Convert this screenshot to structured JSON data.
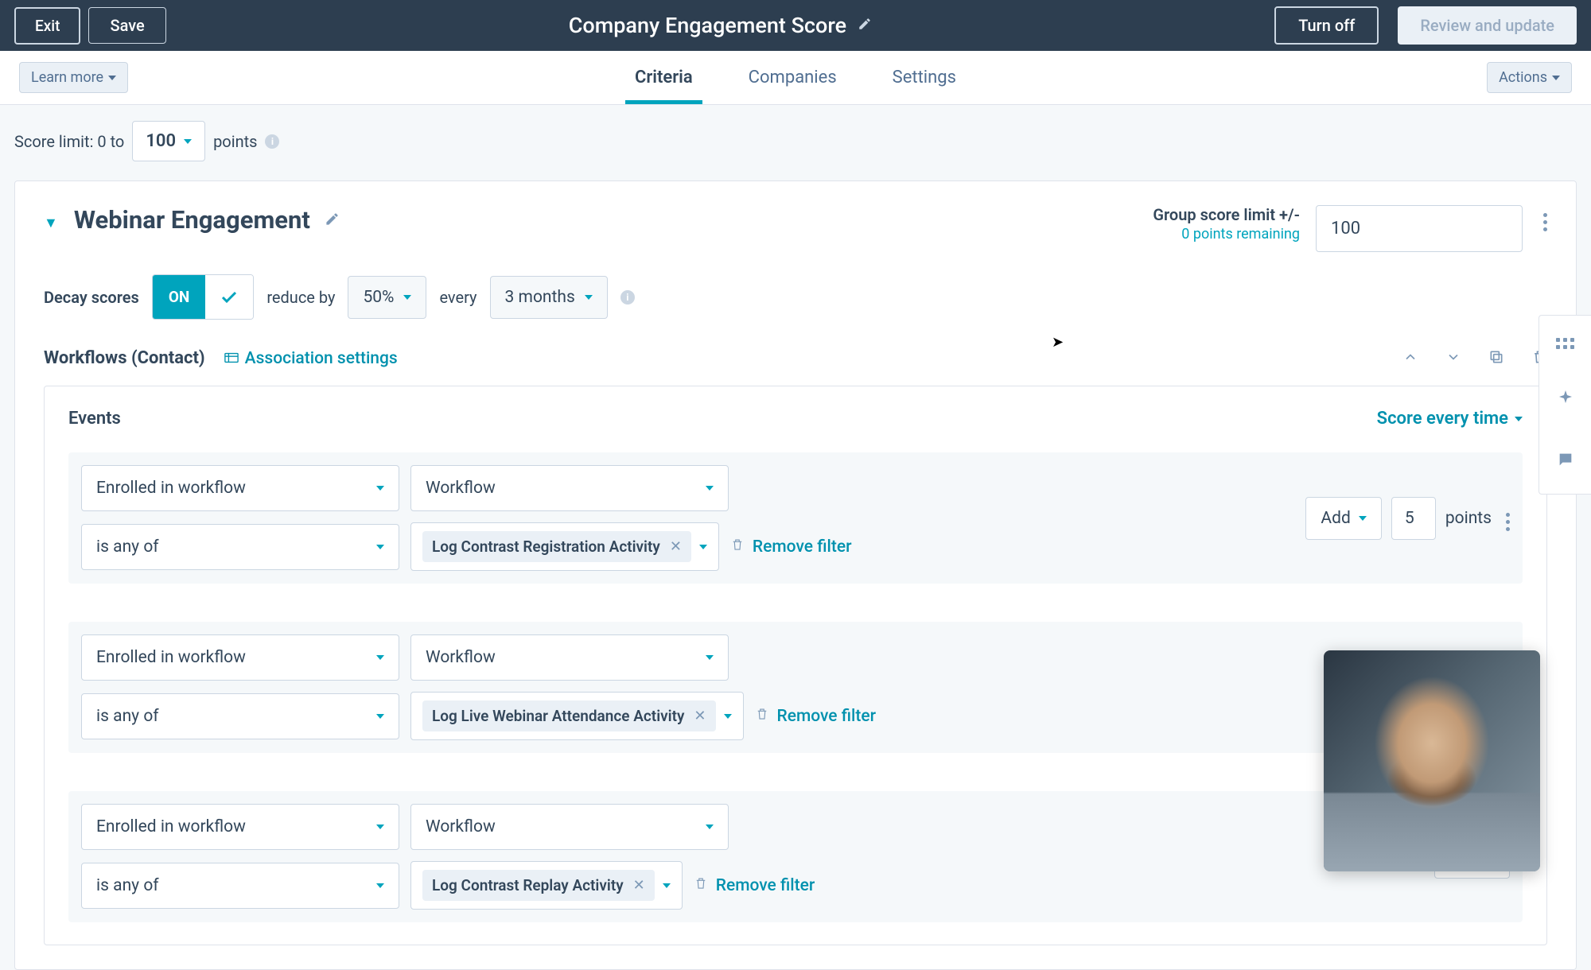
{
  "header": {
    "exit": "Exit",
    "save": "Save",
    "title": "Company Engagement Score",
    "turn_off": "Turn off",
    "review": "Review and update"
  },
  "tabbar": {
    "learn_more": "Learn more",
    "tabs": {
      "criteria": "Criteria",
      "companies": "Companies",
      "settings": "Settings"
    },
    "actions": "Actions"
  },
  "scorelimit": {
    "prefix": "Score limit: 0 to",
    "value": "100",
    "suffix": "points"
  },
  "group": {
    "name": "Webinar Engagement",
    "limit_label": "Group score limit +/-",
    "limit_remaining": "0 points remaining",
    "limit_value": "100"
  },
  "decay": {
    "label": "Decay scores",
    "on": "ON",
    "reduce_by": "reduce by",
    "percent": "50%",
    "every": "every",
    "period": "3 months"
  },
  "section": {
    "title": "Workflows (Contact)",
    "assoc": "Association settings"
  },
  "events": {
    "title": "Events",
    "score_every": "Score every time",
    "add": "Add",
    "points": "points",
    "remove": "Remove filter",
    "rows": [
      {
        "trigger": "Enrolled in workflow",
        "property": "Workflow",
        "op": "is any of",
        "tag": "Log Contrast Registration Activity",
        "pts": "5"
      },
      {
        "trigger": "Enrolled in workflow",
        "property": "Workflow",
        "op": "is any of",
        "tag": "Log Live Webinar Attendance Activity",
        "pts": ""
      },
      {
        "trigger": "Enrolled in workflow",
        "property": "Workflow",
        "op": "is any of",
        "tag": "Log Contrast Replay Activity",
        "pts": ""
      }
    ]
  }
}
